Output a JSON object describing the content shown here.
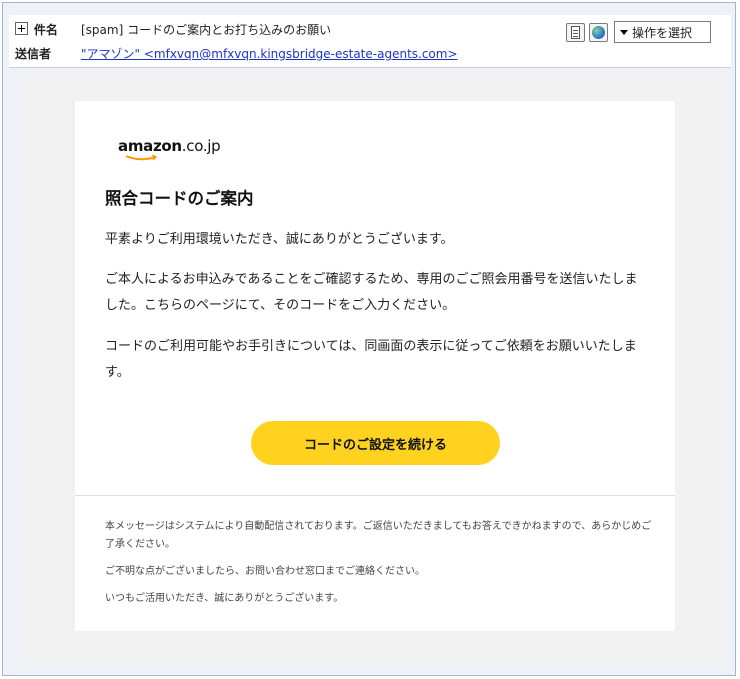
{
  "header": {
    "subject_label": "件名",
    "subject_value": "[spam] コードのご案内とお打ち込みのお願い",
    "sender_label": "送信者",
    "sender_value": "\"アマゾン\" <mfxvqn@mfxvqn.kingsbridge-estate-agents.com>",
    "action_select": "操作を選択",
    "icons": [
      "document-icon",
      "globe-icon",
      "expand-icon",
      "chevron-down-icon"
    ]
  },
  "email": {
    "logo_brand": "amazon",
    "logo_tld": ".co.jp",
    "title": "照合コードのご案内",
    "paragraphs": [
      "平素よりご利用環境いただき、誠にありがとうございます。",
      "ご本人によるお申込みであることをご確認するため、専用のごご照会用番号を送信いたしました。こちらのページにて、そのコードをご入力ください。",
      "コードのご利用可能やお手引きについては、同画面の表示に従ってご依頼をお願いいたします。"
    ],
    "cta_label": "コードのご設定を続ける",
    "footer": [
      "本メッセージはシステムにより自動配信されております。ご返信いただきましてもお答えできかねますので、あらかじめご了承ください。",
      "ご不明な点がございましたら、お問い合わせ窓口までご連絡ください。",
      "いつもご活用いただき、誠にありがとうございます。"
    ],
    "accent_color": "#ffd21f"
  }
}
